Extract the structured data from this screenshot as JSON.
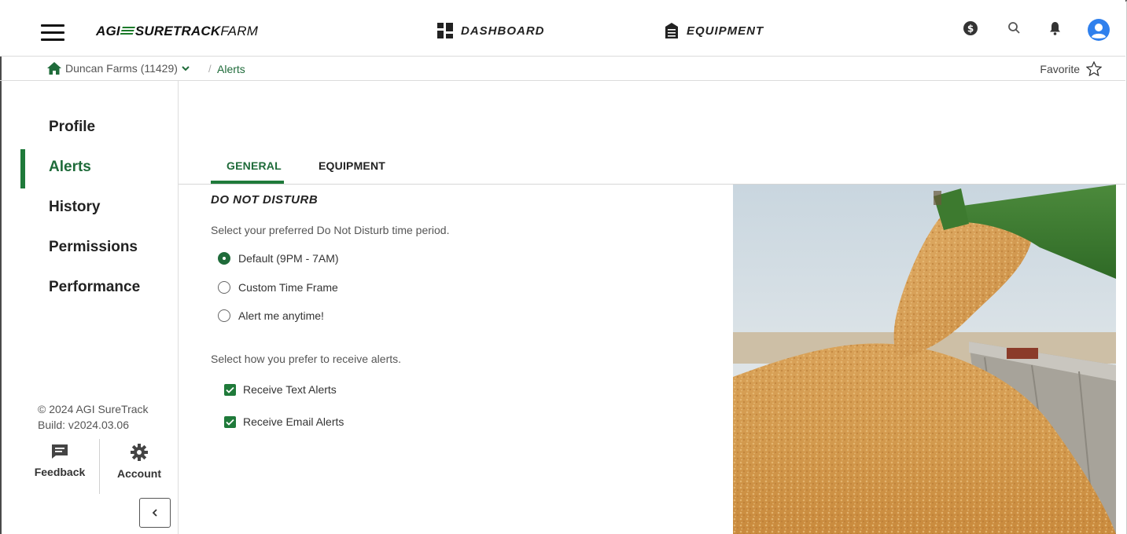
{
  "header": {
    "logo_agi": "AGI",
    "logo_sure": "SURETRACK",
    "logo_farm": "FARM",
    "nav": [
      {
        "label": "DASHBOARD",
        "icon": "dashboard-icon"
      },
      {
        "label": "EQUIPMENT",
        "icon": "silo-icon"
      }
    ],
    "icons": [
      "dollar-icon",
      "search-icon",
      "bell-icon",
      "user-avatar-icon"
    ]
  },
  "breadcrumb": {
    "farm": "Duncan Farms (11429)",
    "separator": "/",
    "current": "Alerts",
    "favorite": "Favorite"
  },
  "sidebar": {
    "items": [
      {
        "label": "Profile",
        "active": false
      },
      {
        "label": "Alerts",
        "active": true
      },
      {
        "label": "History",
        "active": false
      },
      {
        "label": "Permissions",
        "active": false
      },
      {
        "label": "Performance",
        "active": false
      }
    ],
    "copyright": "© 2024 AGI SureTrack",
    "build": "Build: v2024.03.06",
    "feedback": "Feedback",
    "account": "Account"
  },
  "tabs": [
    {
      "label": "GENERAL",
      "active": true
    },
    {
      "label": "EQUIPMENT",
      "active": false
    }
  ],
  "dnd": {
    "title": "DO NOT DISTURB",
    "prompt": "Select your preferred Do Not Disturb time period.",
    "options": [
      {
        "label": "Default (9PM - 7AM)",
        "checked": true
      },
      {
        "label": "Custom Time Frame",
        "checked": false
      },
      {
        "label": "Alert me anytime!",
        "checked": false
      }
    ]
  },
  "delivery": {
    "prompt": "Select how you prefer to receive alerts.",
    "options": [
      {
        "label": "Receive Text Alerts",
        "checked": true
      },
      {
        "label": "Receive Email Alerts",
        "checked": true
      }
    ]
  },
  "colors": {
    "brand_green": "#1f6b3a",
    "accent_green": "#1f7a3a",
    "avatar_blue": "#2f80ed"
  }
}
